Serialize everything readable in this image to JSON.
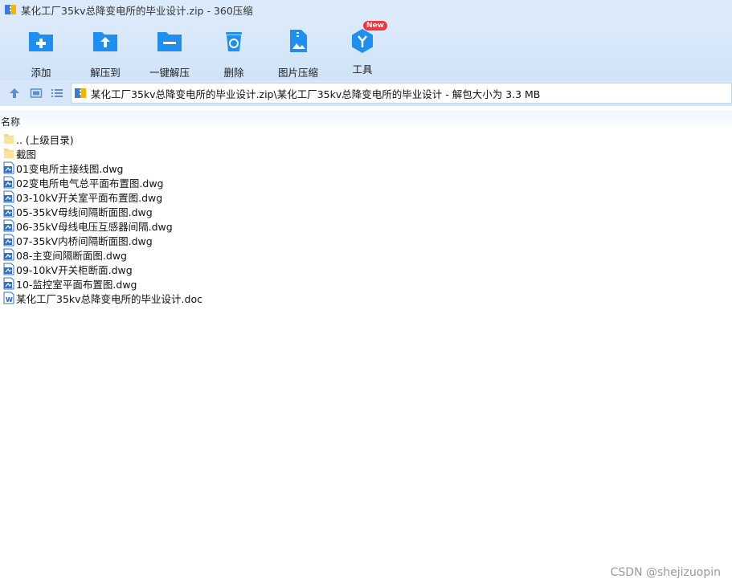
{
  "window": {
    "title": "某化工厂35kv总降变电所的毕业设计.zip - 360压缩"
  },
  "toolbar": {
    "add": "添加",
    "extract_to": "解压到",
    "one_click_extract": "一键解压",
    "delete": "删除",
    "image_compress": "图片压缩",
    "tools": "工具",
    "tools_badge": "New"
  },
  "address": {
    "path": "某化工厂35kv总降变电所的毕业设计.zip\\某化工厂35kv总降变电所的毕业设计 - 解包大小为 3.3 MB"
  },
  "list": {
    "column_name": "名称",
    "items": [
      {
        "name": ".. (上级目录)",
        "type": "folder"
      },
      {
        "name": "截图",
        "type": "folder"
      },
      {
        "name": "01变电所主接线图.dwg",
        "type": "dwg"
      },
      {
        "name": "02变电所电气总平面布置图.dwg",
        "type": "dwg"
      },
      {
        "name": "03-10kV开关室平面布置图.dwg",
        "type": "dwg"
      },
      {
        "name": "05-35kV母线间隔断面图.dwg",
        "type": "dwg"
      },
      {
        "name": "06-35kV母线电压互感器间隔.dwg",
        "type": "dwg"
      },
      {
        "name": "07-35kV内桥间隔断面图.dwg",
        "type": "dwg"
      },
      {
        "name": "08-主变间隔断面图.dwg",
        "type": "dwg"
      },
      {
        "name": "09-10kV开关柜断面.dwg",
        "type": "dwg"
      },
      {
        "name": "10-监控室平面布置图.dwg",
        "type": "dwg"
      },
      {
        "name": "某化工厂35kv总降变电所的毕业设计.doc",
        "type": "doc"
      }
    ]
  },
  "watermark": "CSDN @shejizuopin",
  "colors": {
    "accent": "#1e8ff0",
    "toolbar_bg": "#d7e7f9",
    "badge": "#f0353d"
  }
}
